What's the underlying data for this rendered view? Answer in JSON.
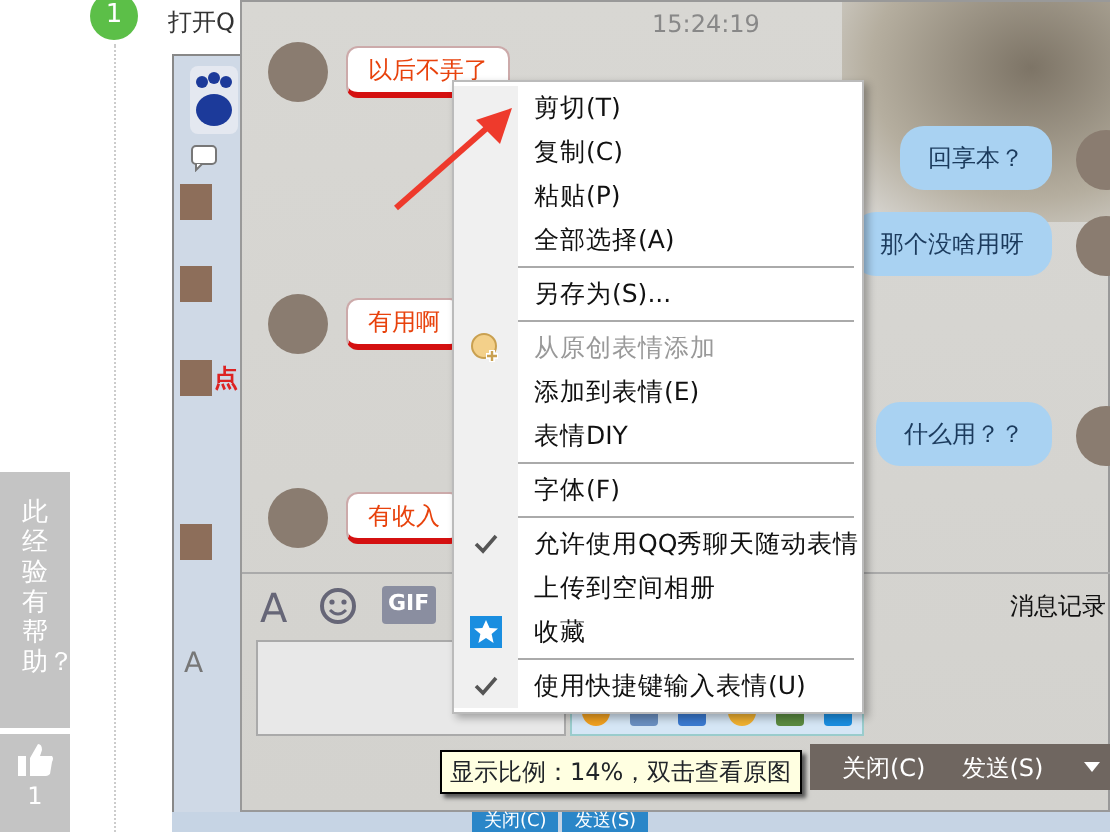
{
  "step": {
    "number": "1",
    "text": "打开Q"
  },
  "vote": {
    "question": "此经验有帮助？",
    "count": "1"
  },
  "back_window": {
    "partial_text": "点",
    "input_font_button": "A"
  },
  "chat": {
    "timestamp": "15:24:19",
    "messages": [
      {
        "kind": "incoming",
        "text": "以后不弄了"
      },
      {
        "kind": "outgoing",
        "text": "回享本？"
      },
      {
        "kind": "outgoing",
        "text": "那个没啥用呀"
      },
      {
        "kind": "incoming",
        "text": "有用啊"
      },
      {
        "kind": "outgoing",
        "text": "什么用？？"
      },
      {
        "kind": "incoming",
        "text": "有收入"
      }
    ],
    "toolbar": {
      "font_button": "A",
      "gif_button": "GIF",
      "history": "消息记录"
    },
    "tooltip": "显示比例：14%，双击查看原图",
    "buttons": [
      "关闭(C)",
      "发送(S)"
    ],
    "taskbar_buttons": [
      "关闭(C)",
      "发送(S)"
    ]
  },
  "context_menu": [
    {
      "kind": "plain",
      "label": "剪切(T)",
      "checked": false,
      "disabled": false
    },
    {
      "kind": "plain",
      "label": "复制(C)",
      "checked": false,
      "disabled": false
    },
    {
      "kind": "plain",
      "label": "粘贴(P)",
      "checked": false,
      "disabled": false
    },
    {
      "kind": "plain",
      "label": "全部选择(A)",
      "checked": false,
      "disabled": false
    },
    {
      "kind": "separator"
    },
    {
      "kind": "plain",
      "label": "另存为(S)...",
      "checked": false,
      "disabled": false
    },
    {
      "kind": "separator"
    },
    {
      "kind": "emoticon",
      "label": "从原创表情添加",
      "checked": false,
      "disabled": true
    },
    {
      "kind": "plain",
      "label": "添加到表情(E)",
      "checked": false,
      "disabled": false
    },
    {
      "kind": "plain",
      "label": "表情DIY",
      "checked": false,
      "disabled": false
    },
    {
      "kind": "separator"
    },
    {
      "kind": "plain",
      "label": "字体(F)",
      "checked": false,
      "disabled": false
    },
    {
      "kind": "separator"
    },
    {
      "kind": "plain",
      "label": "允许使用QQ秀聊天随动表情",
      "checked": true,
      "disabled": false
    },
    {
      "kind": "plain",
      "label": "上传到空间相册",
      "checked": false,
      "disabled": false
    },
    {
      "kind": "favorite",
      "label": "收藏",
      "checked": false,
      "disabled": false
    },
    {
      "kind": "separator"
    },
    {
      "kind": "plain",
      "label": "使用快捷键输入表情(U)",
      "checked": true,
      "disabled": false
    }
  ]
}
